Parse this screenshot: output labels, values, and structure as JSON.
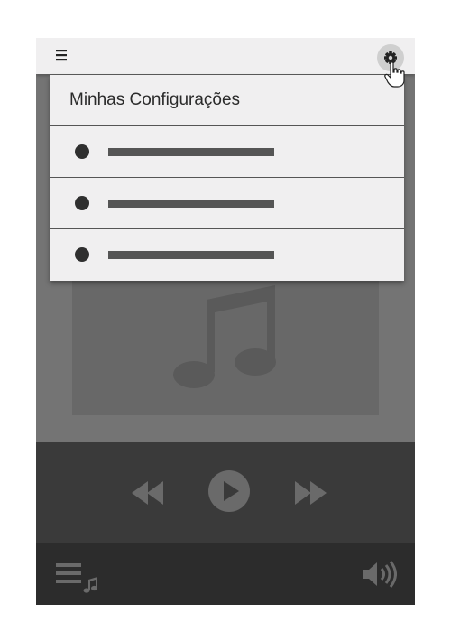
{
  "app": {
    "topbar": {
      "menu_icon": "hamburger-menu-icon",
      "settings_icon": "gear-icon"
    },
    "settings_menu": {
      "title": "Minhas Configurações",
      "items": [
        {
          "placeholder": "text-line-placeholder"
        },
        {
          "placeholder": "text-line-placeholder"
        },
        {
          "placeholder": "text-line-placeholder"
        }
      ]
    },
    "player": {
      "artwork_icon": "music-note-icon",
      "controls": [
        "rewind-icon",
        "play-icon",
        "fast-forward-icon"
      ],
      "bottom": [
        "playlist-icon",
        "volume-icon"
      ]
    }
  }
}
